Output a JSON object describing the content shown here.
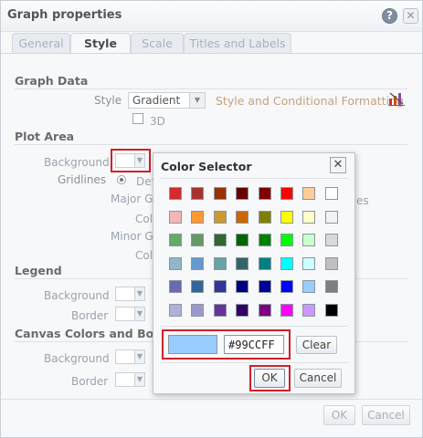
{
  "window": {
    "title": "Graph properties",
    "help_glyph": "?",
    "close_glyph": "✕"
  },
  "tabs": [
    {
      "label": "General",
      "active": false
    },
    {
      "label": "Style",
      "active": true
    },
    {
      "label": "Scale",
      "active": false
    },
    {
      "label": "Titles and Labels",
      "active": false
    }
  ],
  "graph_data": {
    "section": "Graph Data",
    "style_label": "Style",
    "style_value": "Gradient",
    "style_link": "Style and Conditional Formatting",
    "three_d_label": "3D",
    "three_d_checked": false
  },
  "plot_area": {
    "section": "Plot Area",
    "background_label": "Background",
    "gridlines_label": "Gridlines",
    "default_option": "Def",
    "major_label": "Major Gr",
    "color_label_1": "Colo",
    "minor_label": "Minor Gr",
    "color_label_2": "Colo",
    "right_fragment": "es"
  },
  "legend": {
    "section": "Legend",
    "background_label": "Background",
    "border_label": "Border"
  },
  "canvas": {
    "section": "Canvas Colors and Borde",
    "background_label": "Background",
    "border_label": "Border"
  },
  "footer": {
    "ok": "OK",
    "cancel": "Cancel"
  },
  "color_selector": {
    "title": "Color Selector",
    "close_glyph": "✕",
    "palette": [
      [
        "#d22c2c",
        "#a83232",
        "#993300",
        "#660000",
        "#800000",
        "#ff0000",
        "#ffcc99",
        "#ffffff"
      ],
      [
        "#f0b8b8",
        "#ff9933",
        "#cc9933",
        "#cc6600",
        "#808000",
        "#ffff00",
        "#ffffcc",
        "#f2f2f2"
      ],
      [
        "#66aa66",
        "#669966",
        "#336633",
        "#006600",
        "#008000",
        "#00ff00",
        "#ccffcc",
        "#d9d9d9"
      ],
      [
        "#8fb8c8",
        "#6699cc",
        "#66a3a3",
        "#336666",
        "#008080",
        "#00ffff",
        "#ccffff",
        "#bfbfbf"
      ],
      [
        "#6a6ab0",
        "#336699",
        "#333399",
        "#000080",
        "#000099",
        "#0000ff",
        "#99ccff",
        "#7f7f7f"
      ],
      [
        "#b0b0d8",
        "#9999cc",
        "#663399",
        "#330066",
        "#800080",
        "#ff00ff",
        "#cc99ff",
        "#000000"
      ]
    ],
    "current_color": "#99CCFF",
    "hex_value": "#99CCFF",
    "clear_label": "Clear",
    "ok_label": "OK",
    "cancel_label": "Cancel"
  },
  "colors": {
    "accent_highlight": "#d0202a",
    "link": "#c8a27c"
  }
}
